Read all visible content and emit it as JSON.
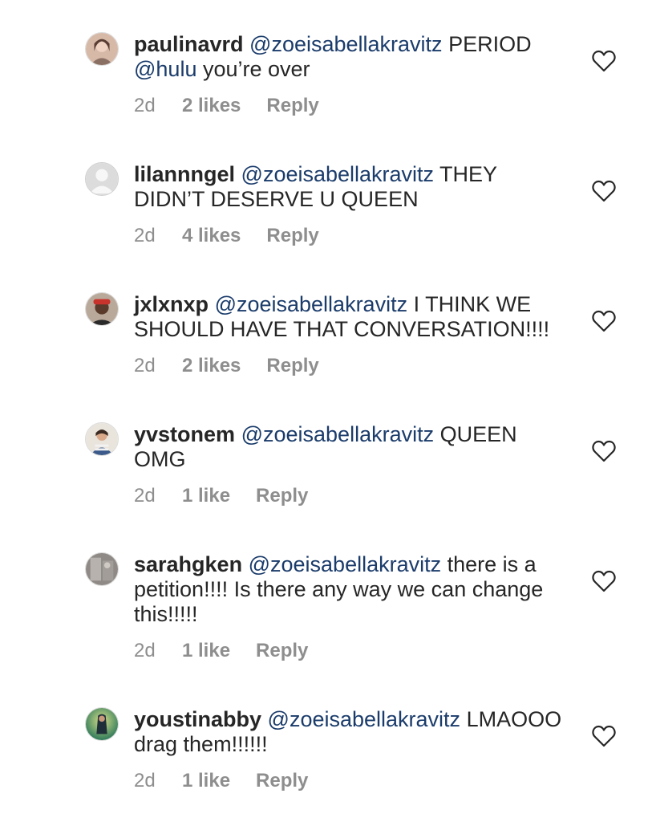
{
  "comments": [
    {
      "username": "paulinavrd",
      "mention": "@zoeisabellakravitz",
      "text_before": " PERIOD ",
      "mention2": "@hulu",
      "text_after": " you’re over",
      "time": "2d",
      "likes": "2 likes",
      "reply": "Reply",
      "avatar_icon": "user-photo",
      "avatar_color": "#d7b9a8"
    },
    {
      "username": "lilannngel",
      "mention": "@zoeisabellakravitz",
      "text": " THEY DIDN’T DESERVE U QUEEN",
      "time": "2d",
      "likes": "4 likes",
      "reply": "Reply",
      "avatar_icon": "default-avatar",
      "avatar_color": "#c7c7c7"
    },
    {
      "username": "jxlxnxp",
      "mention": "@zoeisabellakravitz",
      "text": " I THINK WE SHOULD HAVE THAT CONVERSATION!!!!",
      "time": "2d",
      "likes": "2 likes",
      "reply": "Reply",
      "avatar_icon": "user-photo",
      "avatar_color": "#6b4a3a"
    },
    {
      "username": "yvstonem",
      "mention": "@zoeisabellakravitz",
      "text": " QUEEN OMG",
      "time": "2d",
      "likes": "1 like",
      "reply": "Reply",
      "avatar_icon": "user-photo",
      "avatar_color": "#9fb5c9"
    },
    {
      "username": "sarahgken",
      "mention": "@zoeisabellakravitz",
      "text": " there is a petition!!!! Is there any way we can change this!!!!!",
      "time": "2d",
      "likes": "1 like",
      "reply": "Reply",
      "avatar_icon": "user-photo",
      "avatar_color": "#a9a4a0"
    },
    {
      "username": "youstinabby",
      "mention": "@zoeisabellakravitz",
      "text": " LMAOOO drag them!!!!!!",
      "time": "2d",
      "likes": "1 like",
      "reply": "Reply",
      "avatar_icon": "user-photo",
      "avatar_color": "#4a8a6a"
    }
  ],
  "colors": {
    "text": "#262626",
    "mention": "#1b3c6b",
    "meta": "#8e8e8e"
  },
  "like_icon": "heart-outline-icon"
}
